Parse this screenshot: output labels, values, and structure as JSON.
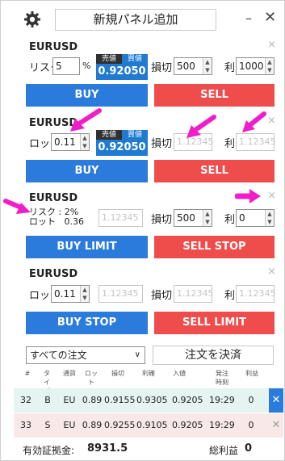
{
  "header": {
    "add_panel_label": "新規パネル追加",
    "minimize_glyph": "–",
    "close_glyph": "✕"
  },
  "panel_close_glyph": "×",
  "spin_up": "▲",
  "spin_down": "▼",
  "panels": [
    {
      "symbol": "EURUSD",
      "risk_label": "リスク",
      "risk_value": "5",
      "risk_unit": "%",
      "price_sell_label": "売値",
      "price_buy_label": "買値",
      "price": "0.92050",
      "sl_label": "損切",
      "sl_value": "500",
      "tp_label": "利",
      "tp_value": "1000",
      "buy_label": "BUY",
      "sell_label": "SELL"
    },
    {
      "symbol": "EURUSD",
      "lot_label": "ロット",
      "lot_value": "0.11",
      "price_sell_label": "売値",
      "price_buy_label": "買値",
      "price": "0.92050",
      "sl_label": "損切",
      "sl_placeholder": "1.12345",
      "tp_label": "利",
      "tp_placeholder": "1.12345",
      "buy_label": "BUY",
      "sell_label": "SELL"
    },
    {
      "symbol": "EURUSD",
      "risk_label": "リスク",
      "risk_value": "2%",
      "lot_label": "ロット",
      "lot_value": "0.36",
      "entry_placeholder": "1.12345",
      "sl_label": "損切",
      "sl_value": "500",
      "tp_label": "利",
      "tp_value": "0",
      "buy_label": "BUY LIMIT",
      "sell_label": "SELL STOP"
    },
    {
      "symbol": "EURUSD",
      "lot_label": "ロット",
      "lot_value": "0.11",
      "entry_placeholder": "1.12345",
      "sl_label": "損切",
      "sl_placeholder": "1.12345",
      "tp_label": "利",
      "tp_placeholder": "1.12345",
      "buy_label": "BUY STOP",
      "sell_label": "SELL LIMIT"
    }
  ],
  "orders": {
    "filter_selected": "すべての注文",
    "close_all_label": "注文を決済",
    "columns": [
      "#",
      "タイプ",
      "通貨",
      "ロット",
      "損切",
      "利確",
      "入値",
      "発注時刻",
      "利益"
    ],
    "rows": [
      {
        "id": "32",
        "type": "B",
        "symbol": "EU",
        "lot": "0.89",
        "sl": "0.9155",
        "tp": "0.9305",
        "entry": "0.9205",
        "time": "19:29",
        "profit": "0"
      },
      {
        "id": "33",
        "type": "S",
        "symbol": "EU",
        "lot": "0.89",
        "sl": "0.9255",
        "tp": "0.9105",
        "entry": "0.9205",
        "time": "19:29",
        "profit": "0"
      }
    ]
  },
  "footer": {
    "margin_label": "有効証拠金:",
    "margin_value": "8931.5",
    "profit_label": "総利益",
    "profit_value": "0"
  },
  "colors": {
    "buy_button": "#2b7bdc",
    "sell_button": "#ef4c4c",
    "annotation_arrow": "#f01ec8"
  }
}
